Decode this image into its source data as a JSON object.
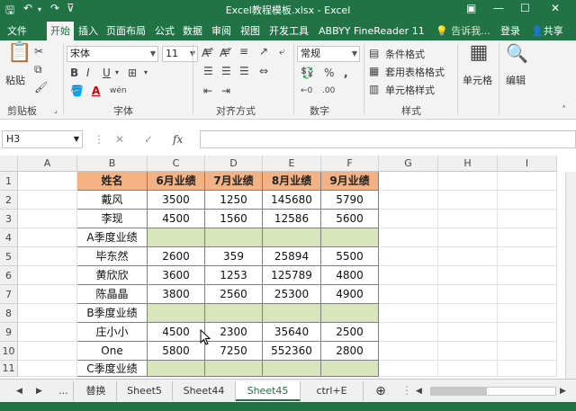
{
  "window": {
    "title": "Excel教程模板.xlsx - Excel"
  },
  "ribbon_tabs": [
    "文件",
    "开始",
    "插入",
    "页面布局",
    "公式",
    "数据",
    "审阅",
    "视图",
    "开发工具",
    "ABBYY FineReader 11"
  ],
  "ribbon_right": {
    "tell": "告诉我...",
    "login": "登录",
    "share": "共享"
  },
  "font_group": {
    "font_name": "宋体",
    "font_size": "11",
    "label": "字体",
    "bold": "B",
    "italic": "I",
    "underline": "U"
  },
  "clipboard_group": {
    "paste": "粘贴",
    "label": "剪贴板"
  },
  "align_group": {
    "label": "对齐方式"
  },
  "number_group": {
    "format": "常规",
    "label": "数字"
  },
  "style_group": {
    "cond": "条件格式",
    "table": "套用表格格式",
    "cell": "单元格样式",
    "label": "样式"
  },
  "cells_group": {
    "label": "单元格"
  },
  "edit_group": {
    "label": "编辑"
  },
  "formula_bar": {
    "name_box": "H3",
    "fx": "fx"
  },
  "columns": [
    "A",
    "B",
    "C",
    "D",
    "E",
    "F",
    "G",
    "H",
    "I"
  ],
  "rows": [
    "1",
    "2",
    "3",
    "4",
    "5",
    "6",
    "7",
    "8",
    "9",
    "10",
    "11"
  ],
  "table": {
    "header": [
      "姓名",
      "6月业绩",
      "7月业绩",
      "8月业绩",
      "9月业绩"
    ],
    "body": [
      [
        "戴风",
        "3500",
        "1250",
        "145680",
        "5790"
      ],
      [
        "李现",
        "4500",
        "1560",
        "12586",
        "5600"
      ],
      [
        "A季度业绩",
        "",
        "",
        "",
        ""
      ],
      [
        "毕东然",
        "2600",
        "359",
        "25894",
        "5500"
      ],
      [
        "黄欣欣",
        "3600",
        "1253",
        "125789",
        "4800"
      ],
      [
        "陈晶晶",
        "3800",
        "2560",
        "25300",
        "4900"
      ],
      [
        "B季度业绩",
        "",
        "",
        "",
        ""
      ],
      [
        "庄小小",
        "4500",
        "2300",
        "35640",
        "2500"
      ],
      [
        "One",
        "5800",
        "7250",
        "552360",
        "2800"
      ],
      [
        "C季度业绩",
        "",
        "",
        "",
        ""
      ]
    ]
  },
  "sheet_tabs": [
    "替换",
    "Sheet5",
    "Sheet44",
    "Sheet45",
    "ctrl+E"
  ],
  "sheet_nav": {
    "ellipsis": "...",
    "add": "⊕"
  },
  "colors": {
    "accent": "#217346",
    "header_fill": "#f4b183",
    "quarter_fill": "#d8e4bc"
  }
}
